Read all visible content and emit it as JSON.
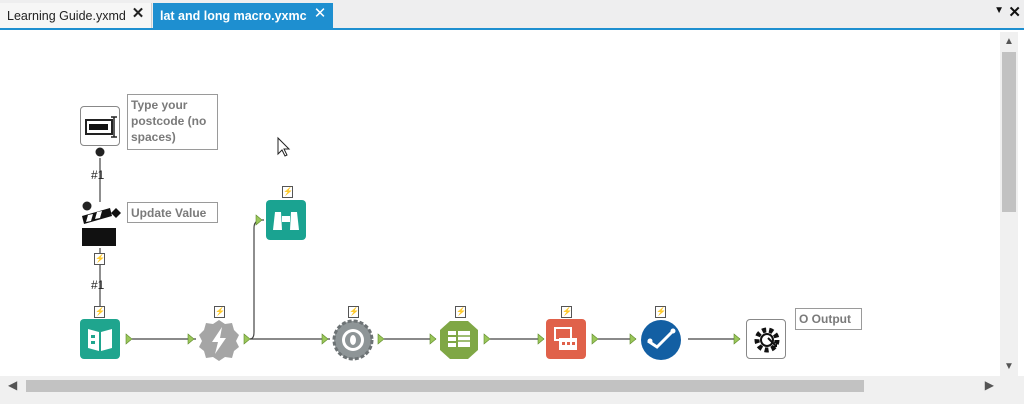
{
  "tabs": [
    {
      "label": "Learning Guide.yxmd",
      "active": false
    },
    {
      "label": "lat and long macro.yxmc",
      "active": true
    }
  ],
  "tab_controls": {
    "close_glyph": "✕",
    "menu_glyph": "▼",
    "close_all_glyph": "✕"
  },
  "colors": {
    "accent": "#1e8fd0",
    "book_tool": "#1fa58e",
    "browse_tool": "#1aa391",
    "formula_tool": "#a5a5a5",
    "geo_tool": "#8e9597",
    "table_tool": "#7fa745",
    "transform_tool": "#e0614a",
    "check_tool": "#135fa3",
    "connector_green": "#9bc75a"
  },
  "annotations": {
    "text_box": "Type your postcode (no spaces)",
    "update_value": "Update Value",
    "output": "O Output"
  },
  "connection_labels": {
    "upper": "#1",
    "lower": "#1"
  },
  "tools": [
    {
      "name": "text-input-tool",
      "icon": "text-box-icon"
    },
    {
      "name": "action-tool",
      "icon": "clapperboard-icon"
    },
    {
      "name": "macro-input-tool",
      "icon": "book-icon"
    },
    {
      "name": "formula-tool",
      "icon": "bolt-gear-icon"
    },
    {
      "name": "browse-tool",
      "icon": "binoculars-icon"
    },
    {
      "name": "geo-tool",
      "icon": "target-gear-icon"
    },
    {
      "name": "table-tool",
      "icon": "table-icon"
    },
    {
      "name": "transform-tool",
      "icon": "transform-icon"
    },
    {
      "name": "check-tool",
      "icon": "checkmark-icon"
    },
    {
      "name": "macro-output-tool",
      "icon": "gear-arrows-icon"
    }
  ],
  "scrollbars": {
    "up": "▲",
    "down": "▼",
    "left": "◀",
    "right": "▶"
  }
}
